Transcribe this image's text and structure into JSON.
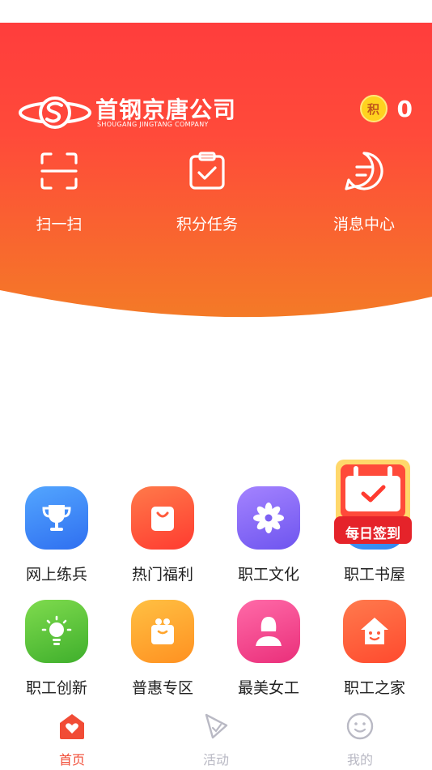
{
  "header": {
    "logo_text": "首钢京唐公司",
    "logo_subtext": "SHOUGANG JINGTANG COMPANY",
    "coin_glyph": "积",
    "points": "0"
  },
  "quick_actions": [
    {
      "label": "扫一扫",
      "icon": "scan-icon"
    },
    {
      "label": "积分任务",
      "icon": "task-clipboard-icon"
    },
    {
      "label": "消息中心",
      "icon": "message-icon"
    }
  ],
  "apps": [
    {
      "label": "网上练兵",
      "icon": "trophy-icon",
      "color": "#3f86f5"
    },
    {
      "label": "热门福利",
      "icon": "shopping-bag-icon",
      "color": "#ff5a3c"
    },
    {
      "label": "职工文化",
      "icon": "flower-icon",
      "color": "#8a6cf5"
    },
    {
      "label": "职工书屋",
      "icon": "book-icon",
      "color": "#3fa0f5"
    },
    {
      "label": "职工创新",
      "icon": "lightbulb-icon",
      "color": "#5cc73a"
    },
    {
      "label": "普惠专区",
      "icon": "gift-icon",
      "color": "#ffa726"
    },
    {
      "label": "最美女工",
      "icon": "woman-icon",
      "color": "#f2478c"
    },
    {
      "label": "职工之家",
      "icon": "home-icon",
      "color": "#ff5e3a"
    }
  ],
  "daily_signin": {
    "label": "每日签到"
  },
  "tabbar": [
    {
      "label": "首页",
      "icon": "home-heart-icon",
      "active": true
    },
    {
      "label": "活动",
      "icon": "activity-icon",
      "active": false
    },
    {
      "label": "我的",
      "icon": "profile-smile-icon",
      "active": false
    }
  ],
  "colors": {
    "header_top": "#ff3f3c",
    "header_bottom": "#f5772a",
    "tab_active": "#f14c36",
    "tab_inactive": "#b9b9c4"
  }
}
